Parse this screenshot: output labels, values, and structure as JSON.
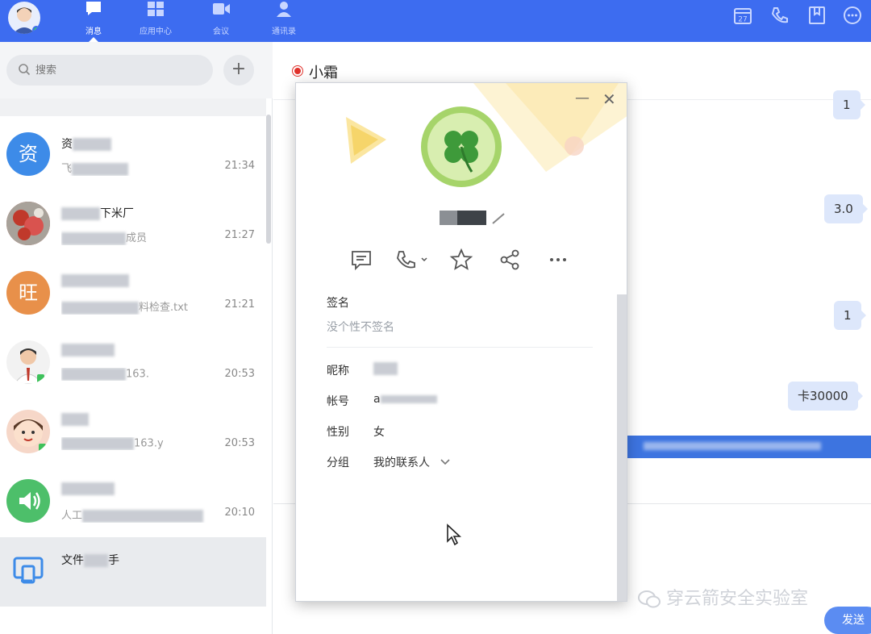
{
  "topbar": {
    "tabs": [
      {
        "label": "消息",
        "icon": "chat-icon",
        "active": true
      },
      {
        "label": "应用中心",
        "icon": "apps-icon",
        "active": false
      },
      {
        "label": "会议",
        "icon": "video-icon",
        "active": false
      },
      {
        "label": "通讯录",
        "icon": "contacts-icon",
        "active": false
      }
    ],
    "right_icons": [
      "calendar-icon",
      "phone-settings-icon",
      "bookmark-icon",
      "more-icon"
    ],
    "calendar_day": "27",
    "accent_color": "#3d6cf0"
  },
  "sidebar": {
    "search_placeholder": "搜索",
    "add_label": "+",
    "conversations": [
      {
        "avatar_text": "资",
        "avatar_color": "#3d8be8",
        "name": "资",
        "preview": "飞",
        "time": "21:34"
      },
      {
        "avatar_text": "",
        "avatar_color": "#b84a3a",
        "name": "下米厂",
        "preview": "成员",
        "time": "21:27"
      },
      {
        "avatar_text": "旺",
        "avatar_color": "#e8904a",
        "name": "",
        "preview": "料检查.txt",
        "time": "21:21"
      },
      {
        "avatar_text": "",
        "avatar_color": "#f2f2f2",
        "name": "",
        "preview": "163.",
        "time": "20:53"
      },
      {
        "avatar_text": "",
        "avatar_color": "#f6d7c8",
        "name": "",
        "preview": "163.y",
        "time": "20:53"
      },
      {
        "avatar_text": "",
        "avatar_color": "#4dbf6a",
        "name": "",
        "preview": "人工",
        "time": "20:10"
      },
      {
        "avatar_text": "",
        "avatar_color": "#3d8be8",
        "name": "文件",
        "name_suffix": "手",
        "preview": "",
        "time": ""
      }
    ]
  },
  "chat": {
    "title": "小霜",
    "status_color": "#e0322c",
    "bubbles": [
      "1",
      "3.0",
      "1",
      "卡30000"
    ],
    "send_label": "发送",
    "watermark": "穿云箭安全实验室"
  },
  "profile": {
    "signature_label": "签名",
    "signature_value": "没个性不签名",
    "fields": [
      {
        "label": "昵称",
        "value": ""
      },
      {
        "label": "帐号",
        "value": "a"
      },
      {
        "label": "性别",
        "value": "女"
      },
      {
        "label": "分组",
        "value": "我的联系人"
      }
    ],
    "actions": [
      "message-icon",
      "call-icon",
      "star-icon",
      "share-icon",
      "more-icon"
    ]
  }
}
